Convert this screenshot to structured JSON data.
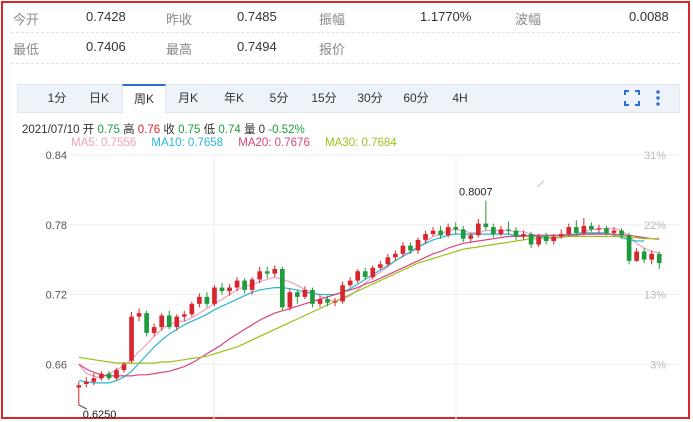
{
  "quote": {
    "row1": [
      {
        "label": "今开",
        "value": "0.7428"
      },
      {
        "label": "昨收",
        "value": "0.7485"
      },
      {
        "label": "振幅",
        "value": "1.1770%"
      },
      {
        "label": "波幅",
        "value": "0.0088"
      }
    ],
    "row2": [
      {
        "label": "最低",
        "value": "0.7406"
      },
      {
        "label": "最高",
        "value": "0.7494"
      },
      {
        "label": "报价",
        "value": ""
      }
    ]
  },
  "tabs": [
    "1分",
    "日K",
    "周K",
    "月K",
    "年K",
    "5分",
    "15分",
    "30分",
    "60分",
    "4H"
  ],
  "active_tab": "周K",
  "tools": {
    "fullscreen_icon": "fullscreen-icon",
    "more_icon": "more-vertical-icon"
  },
  "info": {
    "date": "2021/07/10",
    "open_label": "开",
    "open": "0.75",
    "high_label": "高",
    "high": "0.76",
    "close_label": "收",
    "close": "0.75",
    "low_label": "低",
    "low": "0.74",
    "volume_label": "量",
    "volume": "0",
    "change": "-0.52%"
  },
  "ma": [
    {
      "label": "MA5: 0.7556",
      "color": "#f0a0bd"
    },
    {
      "label": "MA10: 0.7658",
      "color": "#25b9d6"
    },
    {
      "label": "MA20: 0.7676",
      "color": "#d8457e"
    },
    {
      "label": "MA30: 0.7684",
      "color": "#9bc11b"
    }
  ],
  "colors": {
    "up": "#d8262d",
    "down": "#1f9b3d",
    "accent": "#2d6fd0",
    "border": "#d8262d"
  },
  "chart_data": {
    "type": "candlestick",
    "ylim": [
      0.625,
      0.84
    ],
    "yticks": [
      "0.84",
      "0.78",
      "0.72",
      "0.66"
    ],
    "pct_ticks": [
      "31%",
      "22%",
      "13%",
      "3%"
    ],
    "annotations": {
      "max": "0.8007",
      "min": "0.6250"
    },
    "candles": [
      [
        0.64,
        0.642,
        0.645,
        0.625
      ],
      [
        0.643,
        0.645,
        0.649,
        0.64
      ],
      [
        0.645,
        0.648,
        0.652,
        0.642
      ],
      [
        0.648,
        0.652,
        0.654,
        0.646
      ],
      [
        0.652,
        0.648,
        0.654,
        0.646
      ],
      [
        0.648,
        0.655,
        0.657,
        0.646
      ],
      [
        0.655,
        0.66,
        0.662,
        0.653
      ],
      [
        0.663,
        0.701,
        0.705,
        0.661
      ],
      [
        0.701,
        0.704,
        0.708,
        0.697
      ],
      [
        0.704,
        0.687,
        0.706,
        0.684
      ],
      [
        0.687,
        0.692,
        0.695,
        0.684
      ],
      [
        0.692,
        0.702,
        0.704,
        0.689
      ],
      [
        0.702,
        0.692,
        0.706,
        0.69
      ],
      [
        0.692,
        0.701,
        0.703,
        0.689
      ],
      [
        0.701,
        0.703,
        0.706,
        0.697
      ],
      [
        0.703,
        0.712,
        0.714,
        0.701
      ],
      [
        0.712,
        0.718,
        0.721,
        0.709
      ],
      [
        0.718,
        0.712,
        0.722,
        0.709
      ],
      [
        0.712,
        0.726,
        0.728,
        0.71
      ],
      [
        0.726,
        0.723,
        0.73,
        0.72
      ],
      [
        0.723,
        0.726,
        0.729,
        0.719
      ],
      [
        0.726,
        0.732,
        0.735,
        0.723
      ],
      [
        0.732,
        0.724,
        0.734,
        0.721
      ],
      [
        0.724,
        0.733,
        0.735,
        0.72
      ],
      [
        0.733,
        0.74,
        0.744,
        0.73
      ],
      [
        0.74,
        0.738,
        0.744,
        0.734
      ],
      [
        0.738,
        0.742,
        0.745,
        0.735
      ],
      [
        0.742,
        0.709,
        0.744,
        0.706
      ],
      [
        0.709,
        0.722,
        0.725,
        0.706
      ],
      [
        0.722,
        0.718,
        0.724,
        0.712
      ],
      [
        0.718,
        0.724,
        0.727,
        0.716
      ],
      [
        0.724,
        0.712,
        0.726,
        0.709
      ],
      [
        0.712,
        0.716,
        0.719,
        0.709
      ],
      [
        0.716,
        0.713,
        0.719,
        0.71
      ],
      [
        0.713,
        0.714,
        0.717,
        0.71
      ],
      [
        0.714,
        0.728,
        0.731,
        0.712
      ],
      [
        0.728,
        0.732,
        0.735,
        0.726
      ],
      [
        0.732,
        0.74,
        0.742,
        0.73
      ],
      [
        0.74,
        0.735,
        0.743,
        0.733
      ],
      [
        0.735,
        0.743,
        0.745,
        0.733
      ],
      [
        0.743,
        0.746,
        0.749,
        0.741
      ],
      [
        0.746,
        0.752,
        0.755,
        0.744
      ],
      [
        0.752,
        0.755,
        0.758,
        0.749
      ],
      [
        0.755,
        0.762,
        0.765,
        0.752
      ],
      [
        0.762,
        0.758,
        0.765,
        0.755
      ],
      [
        0.758,
        0.767,
        0.769,
        0.755
      ],
      [
        0.767,
        0.772,
        0.775,
        0.764
      ],
      [
        0.772,
        0.775,
        0.778,
        0.77
      ],
      [
        0.775,
        0.771,
        0.779,
        0.768
      ],
      [
        0.771,
        0.778,
        0.781,
        0.769
      ],
      [
        0.778,
        0.776,
        0.782,
        0.772
      ],
      [
        0.776,
        0.768,
        0.779,
        0.765
      ],
      [
        0.768,
        0.771,
        0.773,
        0.765
      ],
      [
        0.771,
        0.781,
        0.785,
        0.769
      ],
      [
        0.781,
        0.778,
        0.8007,
        0.775
      ],
      [
        0.778,
        0.772,
        0.781,
        0.769
      ],
      [
        0.772,
        0.776,
        0.779,
        0.77
      ],
      [
        0.776,
        0.775,
        0.783,
        0.772
      ],
      [
        0.775,
        0.77,
        0.778,
        0.767
      ],
      [
        0.77,
        0.772,
        0.775,
        0.767
      ],
      [
        0.772,
        0.763,
        0.774,
        0.76
      ],
      [
        0.763,
        0.77,
        0.772,
        0.761
      ],
      [
        0.77,
        0.766,
        0.773,
        0.763
      ],
      [
        0.766,
        0.77,
        0.772,
        0.763
      ],
      [
        0.77,
        0.772,
        0.776,
        0.768
      ],
      [
        0.772,
        0.778,
        0.781,
        0.77
      ],
      [
        0.778,
        0.773,
        0.784,
        0.771
      ],
      [
        0.773,
        0.779,
        0.786,
        0.771
      ],
      [
        0.779,
        0.776,
        0.782,
        0.774
      ],
      [
        0.776,
        0.777,
        0.78,
        0.773
      ],
      [
        0.777,
        0.773,
        0.779,
        0.771
      ],
      [
        0.773,
        0.775,
        0.778,
        0.772
      ],
      [
        0.775,
        0.771,
        0.777,
        0.768
      ],
      [
        0.771,
        0.749,
        0.773,
        0.746
      ],
      [
        0.749,
        0.757,
        0.76,
        0.748
      ],
      [
        0.757,
        0.75,
        0.76,
        0.747
      ],
      [
        0.75,
        0.755,
        0.758,
        0.746
      ],
      [
        0.755,
        0.747,
        0.757,
        0.742
      ]
    ],
    "series": [
      {
        "name": "MA5",
        "color": "#f0a0bd",
        "values": [
          0.66,
          0.652,
          0.65,
          0.648,
          0.652,
          0.655,
          0.659,
          0.664,
          0.671,
          0.677,
          0.684,
          0.69,
          0.694,
          0.697,
          0.697,
          0.7,
          0.704,
          0.708,
          0.712,
          0.716,
          0.72,
          0.724,
          0.727,
          0.728,
          0.731,
          0.733,
          0.735,
          0.733,
          0.731,
          0.728,
          0.724,
          0.722,
          0.719,
          0.716,
          0.714,
          0.716,
          0.719,
          0.724,
          0.73,
          0.735,
          0.739,
          0.744,
          0.749,
          0.753,
          0.756,
          0.76,
          0.765,
          0.77,
          0.772,
          0.775,
          0.776,
          0.775,
          0.773,
          0.773,
          0.775,
          0.775,
          0.775,
          0.775,
          0.774,
          0.774,
          0.772,
          0.77,
          0.768,
          0.768,
          0.769,
          0.77,
          0.772,
          0.774,
          0.776,
          0.776,
          0.777,
          0.777,
          0.775,
          0.77,
          0.764,
          0.76,
          0.757,
          0.756
        ]
      },
      {
        "name": "MA10",
        "color": "#25b9d6",
        "values": [
          0.646,
          0.645,
          0.644,
          0.644,
          0.644,
          0.646,
          0.649,
          0.654,
          0.661,
          0.668,
          0.675,
          0.681,
          0.686,
          0.69,
          0.694,
          0.697,
          0.7,
          0.703,
          0.707,
          0.71,
          0.713,
          0.716,
          0.719,
          0.722,
          0.724,
          0.725,
          0.726,
          0.726,
          0.725,
          0.724,
          0.722,
          0.721,
          0.72,
          0.72,
          0.72,
          0.722,
          0.725,
          0.729,
          0.733,
          0.737,
          0.741,
          0.745,
          0.749,
          0.753,
          0.757,
          0.761,
          0.764,
          0.767,
          0.769,
          0.771,
          0.772,
          0.772,
          0.772,
          0.772,
          0.772,
          0.772,
          0.772,
          0.772,
          0.771,
          0.771,
          0.77,
          0.77,
          0.77,
          0.771,
          0.771,
          0.772,
          0.772,
          0.773,
          0.773,
          0.773,
          0.773,
          0.771,
          0.769,
          0.767,
          0.766,
          0.766
        ]
      },
      {
        "name": "MA20",
        "color": "#d8457e",
        "values": [
          0.66,
          0.656,
          0.653,
          0.651,
          0.65,
          0.65,
          0.65,
          0.65,
          0.651,
          0.651,
          0.652,
          0.653,
          0.654,
          0.656,
          0.658,
          0.661,
          0.665,
          0.669,
          0.673,
          0.677,
          0.682,
          0.686,
          0.69,
          0.694,
          0.698,
          0.701,
          0.704,
          0.706,
          0.708,
          0.71,
          0.712,
          0.714,
          0.716,
          0.718,
          0.72,
          0.722,
          0.724,
          0.726,
          0.729,
          0.731,
          0.734,
          0.737,
          0.74,
          0.743,
          0.746,
          0.749,
          0.752,
          0.755,
          0.757,
          0.76,
          0.762,
          0.764,
          0.765,
          0.766,
          0.767,
          0.768,
          0.769,
          0.77,
          0.77,
          0.77,
          0.771,
          0.771,
          0.771,
          0.771,
          0.771,
          0.771,
          0.771,
          0.772,
          0.772,
          0.772,
          0.772,
          0.772,
          0.771,
          0.771,
          0.77,
          0.769,
          0.768,
          0.7676
        ]
      },
      {
        "name": "MA30",
        "color": "#9bc11b",
        "values": [
          0.666,
          0.665,
          0.664,
          0.663,
          0.662,
          0.661,
          0.661,
          0.661,
          0.661,
          0.661,
          0.661,
          0.662,
          0.662,
          0.663,
          0.664,
          0.665,
          0.666,
          0.667,
          0.669,
          0.671,
          0.673,
          0.675,
          0.678,
          0.681,
          0.684,
          0.687,
          0.69,
          0.693,
          0.696,
          0.699,
          0.702,
          0.705,
          0.708,
          0.711,
          0.714,
          0.717,
          0.72,
          0.723,
          0.726,
          0.729,
          0.732,
          0.735,
          0.738,
          0.741,
          0.744,
          0.747,
          0.749,
          0.751,
          0.753,
          0.755,
          0.757,
          0.759,
          0.76,
          0.761,
          0.762,
          0.763,
          0.764,
          0.765,
          0.766,
          0.767,
          0.768,
          0.768,
          0.769,
          0.769,
          0.77,
          0.77,
          0.77,
          0.77,
          0.77,
          0.77,
          0.77,
          0.77,
          0.77,
          0.769,
          0.769,
          0.768,
          0.768,
          0.7684
        ]
      }
    ]
  }
}
